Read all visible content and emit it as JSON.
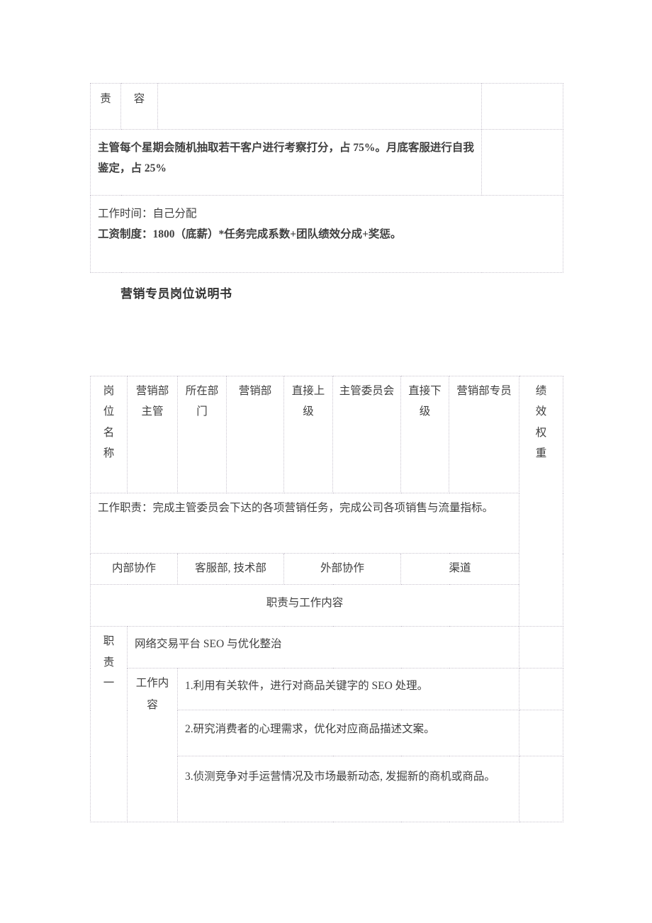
{
  "top_table": {
    "header_row": {
      "col1": "责",
      "col2": "容",
      "col3": "",
      "col4": ""
    },
    "assessment_row": {
      "text": "主管每个星期会随机抽取若干客户进行考察打分，占 75%。月底客服进行自我鉴定，占 25%",
      "col4": ""
    },
    "terms_row": {
      "line1": "工作时间：自己分配",
      "line2": "工资制度：1800（底薪）*任务完成系数+团队绩效分成+奖惩。"
    }
  },
  "section_title": "营销专员岗位说明书",
  "main_table": {
    "header": {
      "position_name_label": "岗位名称",
      "position_name_value": "营销部主管",
      "department_label": "所在部门",
      "department_value": "营销部",
      "superior_label": "直接上级",
      "superior_value": "主管委员会",
      "subordinate_label": "直接下级",
      "subordinate_value": "营销部专员",
      "weight_label": "绩效权重"
    },
    "duties_summary": "工作职责：完成主管委员会下达的各项营销任务，完成公司各项销售与流量指标。",
    "collaboration": {
      "internal_label": "内部协作",
      "internal_value": "客服部, 技术部",
      "external_label": "外部协作",
      "external_value": "渠道"
    },
    "section_header": "职责与工作内容",
    "duty_one": {
      "label": "职责一",
      "title": "网络交易平台 SEO 与优化整治",
      "content_label": "工作内容",
      "items": [
        "1.利用有关软件，进行对商品关键字的 SEO 处理。",
        "2.研究消费者的心理需求，优化对应商品描述文案。",
        "3.侦测竞争对手运营情况及市场最新动态, 发掘新的商机或商品。"
      ]
    }
  }
}
